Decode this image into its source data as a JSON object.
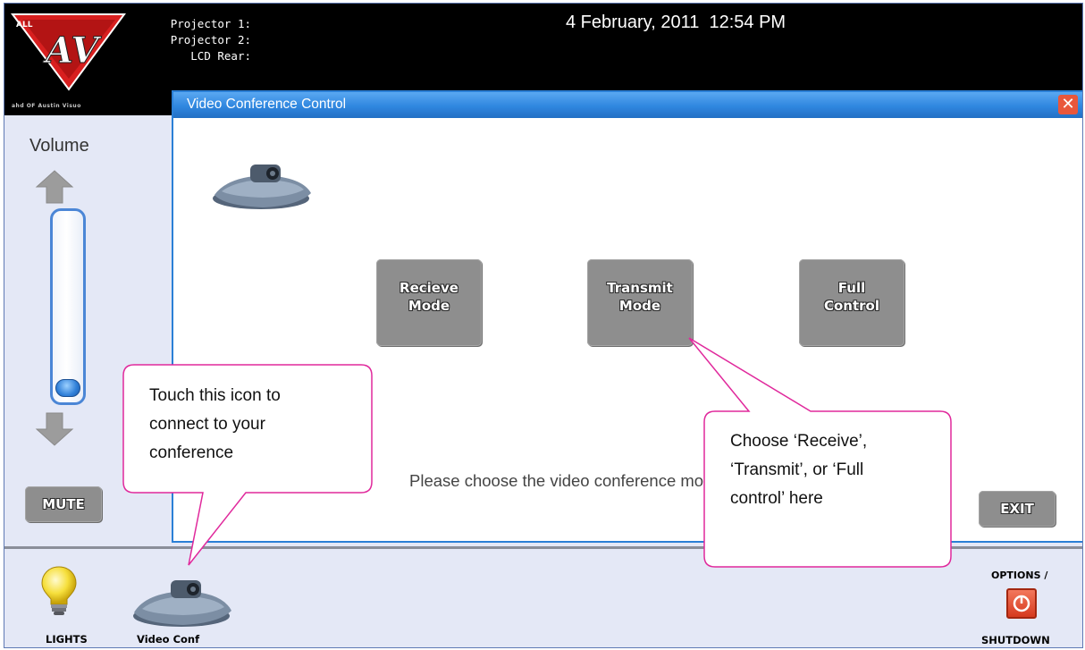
{
  "header": {
    "projector_labels": [
      "Projector 1:",
      "Projector 2:",
      "LCD Rear:"
    ],
    "datetime": "4 February, 2011  12:54 PM",
    "logo_text": "ALL AV",
    "logo_caption": "ahd OF Austin Visuo"
  },
  "volume": {
    "label": "Volume",
    "level": 0.0,
    "mute_label": "MUTE"
  },
  "dialog": {
    "title": "Video Conference Control",
    "buttons": [
      {
        "line1": "Recieve",
        "line2": "Mode"
      },
      {
        "line1": "Transmit",
        "line2": "Mode"
      },
      {
        "line1": "Full",
        "line2": "Control"
      }
    ],
    "message": "Please choose the video conference mode",
    "exit_label": "EXIT"
  },
  "bottom": {
    "lights_label": "LIGHTS",
    "vconf_label": "Video Conf",
    "options_label": "OPTIONS /",
    "shutdown_label": "SHUTDOWN"
  },
  "callouts": {
    "left": "Touch this icon to\nconnect to your\nconference",
    "right": "Choose ‘Receive’,\n‘Transmit’, or ‘Full\ncontrol’ here"
  },
  "colors": {
    "title_bar": "#2f87df",
    "button_gray": "#8e8e8e",
    "callout_border": "#e0299c",
    "close_button": "#e9573b"
  },
  "icons": [
    "logo-icon",
    "arrow-up-icon",
    "arrow-down-icon",
    "video-conference-device-icon",
    "close-icon",
    "light-bulb-icon",
    "power-icon"
  ]
}
